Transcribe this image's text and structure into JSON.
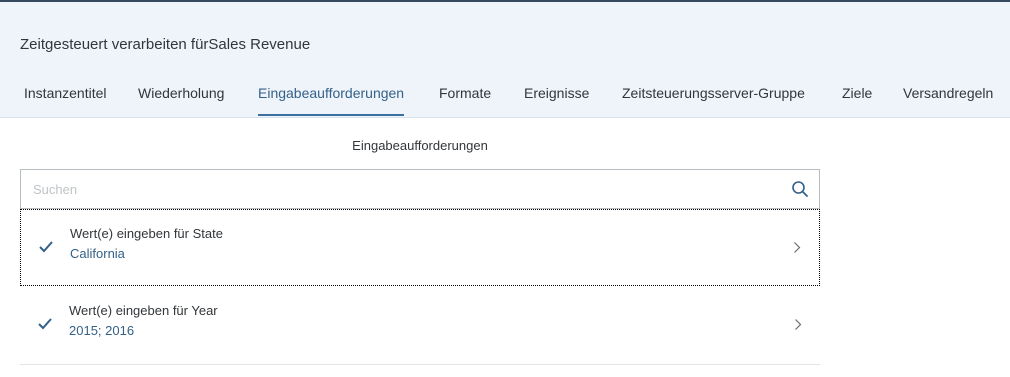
{
  "header": {
    "title": "Zeitgesteuert verarbeiten fürSales Revenue",
    "tabs": [
      {
        "label": "Instanzentitel"
      },
      {
        "label": "Wiederholung"
      },
      {
        "label": "Eingabeaufforderungen",
        "active": true
      },
      {
        "label": "Formate"
      },
      {
        "label": "Ereignisse"
      },
      {
        "label": "Zeitsteuerungsserver-Gruppe"
      },
      {
        "label": "Ziele"
      },
      {
        "label": "Versandregeln"
      }
    ]
  },
  "main": {
    "section_title": "Eingabeaufforderungen",
    "search": {
      "placeholder": "Suchen",
      "value": ""
    },
    "prompts": [
      {
        "label": "Wert(e) eingeben für State",
        "value": "California",
        "checked": true
      },
      {
        "label": "Wert(e) eingeben für Year",
        "value": "2015; 2016",
        "checked": true
      }
    ]
  },
  "colors": {
    "header_bg": "#eff4fb",
    "accent": "#346187",
    "text": "#32363a"
  },
  "icons": [
    "search-icon",
    "check-icon",
    "chevron-right-icon"
  ]
}
